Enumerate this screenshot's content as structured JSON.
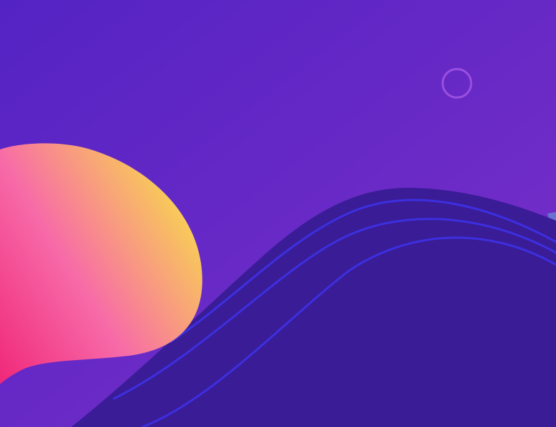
{
  "colors": {
    "background_start": "#5423c4",
    "background_end": "#7a2fc8",
    "wave_fill": "#3a1c96",
    "wave_lines": "#3d2fe0",
    "ring_stroke": "#9a4fe0",
    "blob_yellow": "#f9dc4a",
    "blob_pink": "#f76aa8",
    "blob_magenta": "#f0287a",
    "accent_edge": "#6a7fd0"
  },
  "decorations": {
    "ring_icon": "circle-outline-icon"
  }
}
